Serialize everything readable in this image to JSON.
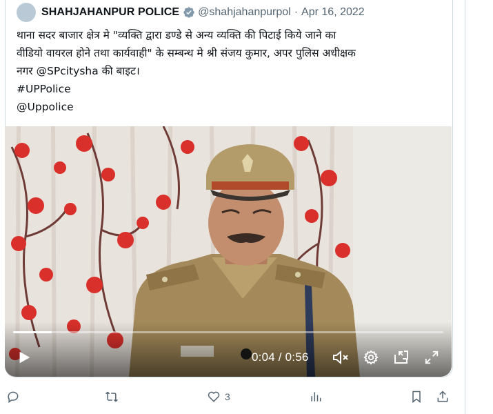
{
  "tweet": {
    "author_name": "SHAHJAHANPUR POLICE",
    "handle": "@shahjahanpurpol",
    "separator": "·",
    "date": "Apr 16, 2022",
    "text_lines": [
      "थाना सदर बाजार क्षेत्र मे \"व्यक्ति द्वारा डण्डे से अन्य व्यक्ति की पिटाई किये जाने का",
      "वीडियो वायरल होने तथा कार्यवाही\" के सम्बन्ध मे श्री संजय कुमार, अपर पुलिस अधीक्षक",
      "नगर @SPcitysha की बाइट।",
      "#UPPolice",
      "@Uppolice"
    ]
  },
  "video": {
    "current_time": "0:04",
    "separator": "/",
    "duration": "0:56",
    "progress_fraction": 0.09,
    "time_display": "0:04 / 0:56"
  },
  "actions": {
    "like_count": "3"
  },
  "icons": {
    "avatar": "avatar",
    "verified": "verified-badge-icon",
    "play": "play-icon",
    "mute": "mute-icon",
    "settings": "gear-icon",
    "pip": "picture-in-picture-icon",
    "fullscreen": "fullscreen-icon",
    "reply": "reply-icon",
    "retweet": "retweet-icon",
    "like": "heart-icon",
    "views": "views-icon",
    "bookmark": "bookmark-icon",
    "share": "share-icon"
  },
  "colors": {
    "verified": "#829aab",
    "curtain_flower": "#d9302b",
    "uniform": "#a48a5a"
  }
}
